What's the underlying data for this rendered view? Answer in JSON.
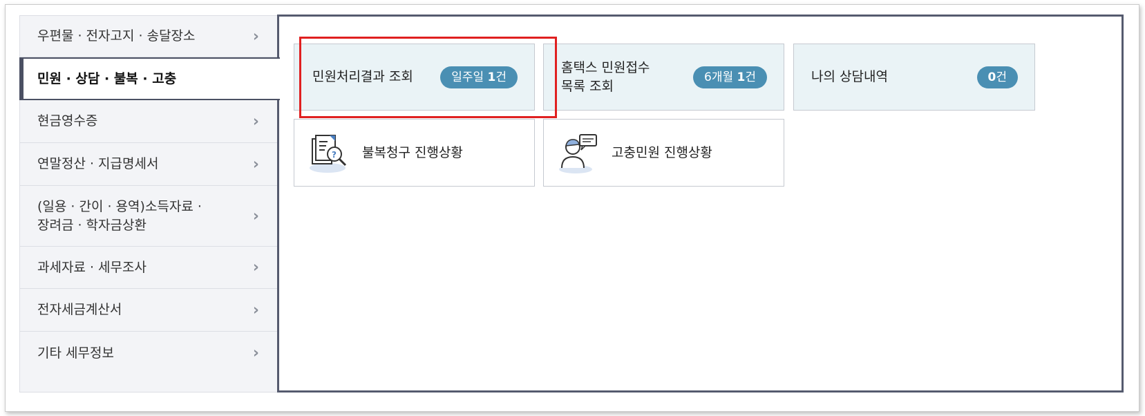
{
  "sidebar": {
    "items": [
      {
        "label": "우편물 · 전자고지 · 송달장소",
        "chevron": "›"
      },
      {
        "label": "민원 · 상담 · 불복 · 고충",
        "chevron": ""
      },
      {
        "label": "현금영수증",
        "chevron": "›"
      },
      {
        "label": "연말정산 · 지급명세서",
        "chevron": "›"
      },
      {
        "label": "(일용 · 간이 · 용역)소득자료 ·\n장려금 · 학자금상환",
        "chevron": "›"
      },
      {
        "label": "과세자료 · 세무조사",
        "chevron": "›"
      },
      {
        "label": "전자세금계산서",
        "chevron": "›"
      },
      {
        "label": "기타 세무정보",
        "chevron": "›"
      }
    ],
    "active_index": 1
  },
  "cards": [
    {
      "title": "민원처리결과 조회",
      "badge_prefix": "일주일 ",
      "badge_count": "1",
      "badge_suffix": "건"
    },
    {
      "title": "홈택스 민원접수\n목록 조회",
      "badge_prefix": "6개월 ",
      "badge_count": "1",
      "badge_suffix": "건"
    },
    {
      "title": "나의 상담내역",
      "badge_prefix": "",
      "badge_count": "0",
      "badge_suffix": "건"
    }
  ],
  "status_cards": [
    {
      "title": "불복청구 진행상황",
      "icon": "document-search-icon"
    },
    {
      "title": "고충민원 진행상황",
      "icon": "person-speech-icon"
    }
  ],
  "colors": {
    "accent_dark": "#555a6e",
    "badge": "#4a8fb3",
    "card_bg": "#eaf3f6",
    "highlight": "#e02020"
  }
}
